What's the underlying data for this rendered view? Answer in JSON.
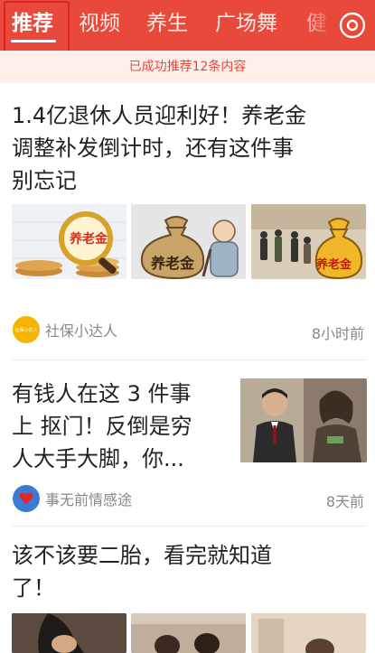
{
  "tabs": [
    {
      "label": "推荐",
      "active": true
    },
    {
      "label": "视频",
      "active": false
    },
    {
      "label": "养生",
      "active": false
    },
    {
      "label": "广场舞",
      "active": false
    },
    {
      "label": "健",
      "active": false
    }
  ],
  "more_icon": "circle-settings-icon",
  "notice": "已成功推荐12条内容",
  "articles": [
    {
      "title_lines": [
        "1.4亿退休人员迎利好！养老金",
        "调整补发倒计时，还有这件事",
        "别忘记"
      ],
      "image_text": [
        "养老金",
        "养老金",
        "养老金"
      ],
      "source": "社保小达人",
      "source_badge": "社保小达人",
      "time": "8小时前"
    },
    {
      "title_lines": [
        "有钱人在这 3 件事",
        "上 抠门！反倒是穷",
        "人大手大脚，你..."
      ],
      "source": "事无前情感途",
      "time": "8天前"
    },
    {
      "title_lines": [
        "该不该要二胎，看完就知道",
        "了！"
      ]
    }
  ],
  "colors": {
    "brand": "#e8493a",
    "notice_bg": "#fdeeea",
    "text": "#222222",
    "meta": "#888888"
  }
}
